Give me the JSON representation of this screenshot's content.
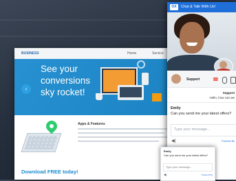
{
  "website": {
    "logo": "BUSINESS",
    "nav": {
      "home": "Home",
      "services": "Service"
    },
    "hero": {
      "title": "See your conversions sky rocket!",
      "arrow_icon": "chevron-right"
    },
    "apps_heading": "Apps & Features",
    "download_label": "Download FREE today!"
  },
  "chat": {
    "logo": "OX",
    "title": "Chat & Talk With Us!",
    "controls": {
      "agent_label": "Support"
    },
    "support_name": "Support",
    "support_msg": "Hello, how can we",
    "emily": {
      "name": "Emily",
      "message": "Can you send me your latest offers?"
    },
    "input_placeholder": "Type your message...",
    "powered_by": "Powered By"
  },
  "mini_chat": {
    "name": "Emily",
    "message": "Can you send me your latest offers?",
    "input_placeholder": "Type your message...",
    "footer": "Powered By"
  },
  "colors": {
    "accent": "#1e6fd9",
    "hero_blue": "#1e8ccf",
    "hangup": "#e74c3c"
  }
}
